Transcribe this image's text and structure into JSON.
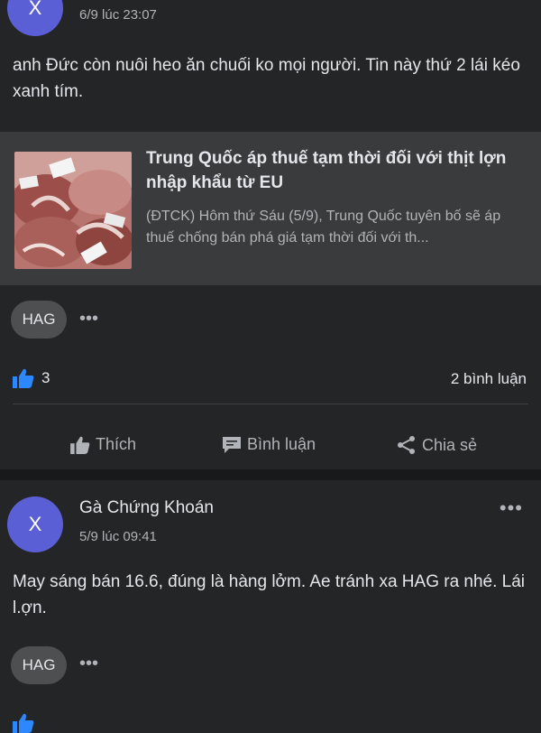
{
  "post1": {
    "avatar_letter": "X",
    "timestamp": "6/9 lúc 23:07",
    "text": "anh Đức còn nuôi heo ăn chuối ko mọi người. Tin này thứ 2 lái kéo xanh tím.",
    "link": {
      "title": "Trung Quốc áp thuế tạm thời đối với thịt lợn nhập khẩu từ EU",
      "description": "(ĐTCK) Hôm thứ Sáu (5/9), Trung Quốc tuyên bố sẽ áp thuế chống bán phá giá tạm thời đối với th..."
    },
    "tag": "HAG",
    "more_dots": "•••",
    "like_count": "3",
    "comment_count": "2 bình luận",
    "actions": {
      "like": "Thích",
      "comment": "Bình luận",
      "share": "Chia sẻ"
    }
  },
  "post2": {
    "avatar_letter": "X",
    "author": "Gà Chứng Khoán",
    "timestamp": "5/9 lúc 09:41",
    "more_dots": "•••",
    "text": "May sáng bán 16.6, đúng là hàng lởm. Ae tránh xa HAG ra nhé. Lái l.ợn.",
    "tag": "HAG",
    "tag_dots": "•••"
  },
  "colors": {
    "background": "#242526",
    "separator": "#18191a",
    "avatar": "#5b5fd6",
    "like_blue": "#2d88ff"
  }
}
